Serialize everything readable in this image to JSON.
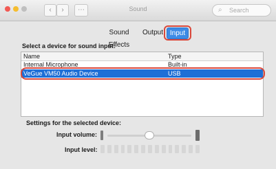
{
  "window": {
    "title": "Sound",
    "back_label": "‹",
    "forward_label": "›",
    "grid_label": "⋯",
    "search_icon_glyph": "⌕",
    "search_placeholder": "Search"
  },
  "colors": {
    "close": "#f25a54",
    "minimize": "#f5bd2f",
    "zoom": "#bfbfbf",
    "accent": "#3d8be6",
    "selection": "#1e6fd6",
    "highlight_box": "#d9473a"
  },
  "tabs": [
    {
      "label": "Sound Effects",
      "selected": false
    },
    {
      "label": "Output",
      "selected": false
    },
    {
      "label": "Input",
      "selected": true
    }
  ],
  "input": {
    "select_label": "Select a device for sound input:",
    "columns": {
      "name": "Name",
      "type": "Type"
    },
    "devices": [
      {
        "name": "Internal Microphone",
        "type": "Built-in",
        "selected": false
      },
      {
        "name": "VeGue VM50 Audio Device",
        "type": "USB",
        "selected": true
      }
    ],
    "settings_label": "Settings for the selected device:",
    "volume_label": "Input volume:",
    "level_label": "Input level:",
    "volume_value": 0.5,
    "level_segments": 15
  },
  "icons": {
    "volume_low": "mic-low-icon",
    "volume_high": "mic-high-icon"
  }
}
